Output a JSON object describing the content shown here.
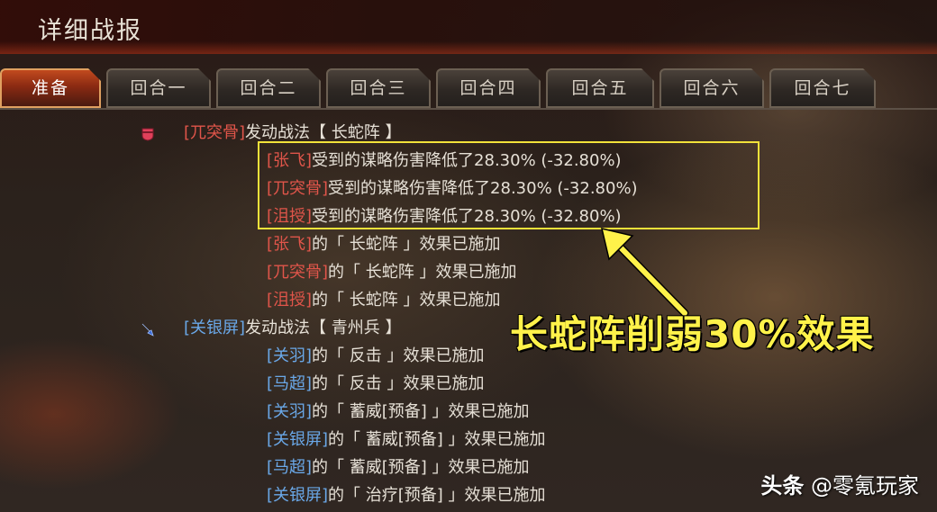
{
  "header": {
    "title": "详细战报"
  },
  "tabs": [
    {
      "label": "准备",
      "active": true
    },
    {
      "label": "回合一",
      "active": false
    },
    {
      "label": "回合二",
      "active": false
    },
    {
      "label": "回合三",
      "active": false
    },
    {
      "label": "回合四",
      "active": false
    },
    {
      "label": "回合五",
      "active": false
    },
    {
      "label": "回合六",
      "active": false
    },
    {
      "label": "回合七",
      "active": false
    }
  ],
  "log": [
    {
      "icon": "red-shield-icon",
      "parts": [
        {
          "t": "[兀突骨]",
          "c": "red"
        },
        {
          "t": "发动战法【 长蛇阵 】",
          "c": ""
        }
      ]
    },
    {
      "parts": [
        {
          "t": "[张飞]",
          "c": "red"
        },
        {
          "t": "受到的谋略伤害降低了28.30% (-32.80%)",
          "c": ""
        }
      ]
    },
    {
      "parts": [
        {
          "t": "[兀突骨]",
          "c": "red"
        },
        {
          "t": "受到的谋略伤害降低了28.30% (-32.80%)",
          "c": ""
        }
      ]
    },
    {
      "parts": [
        {
          "t": "[沮授]",
          "c": "red"
        },
        {
          "t": "受到的谋略伤害降低了28.30% (-32.80%)",
          "c": ""
        }
      ]
    },
    {
      "parts": [
        {
          "t": "[张飞]",
          "c": "red"
        },
        {
          "t": "的「 长蛇阵 」效果已施加",
          "c": ""
        }
      ]
    },
    {
      "parts": [
        {
          "t": "[兀突骨]",
          "c": "red"
        },
        {
          "t": "的「 长蛇阵 」效果已施加",
          "c": ""
        }
      ]
    },
    {
      "parts": [
        {
          "t": "[沮授]",
          "c": "red"
        },
        {
          "t": "的「 长蛇阵 」效果已施加",
          "c": ""
        }
      ]
    },
    {
      "icon": "blue-spear-icon",
      "parts": [
        {
          "t": "[关银屏]",
          "c": "blue"
        },
        {
          "t": "发动战法【 青州兵 】",
          "c": ""
        }
      ]
    },
    {
      "parts": [
        {
          "t": "[关羽]",
          "c": "blue"
        },
        {
          "t": "的「 反击 」效果已施加",
          "c": ""
        }
      ]
    },
    {
      "parts": [
        {
          "t": "[马超]",
          "c": "blue"
        },
        {
          "t": "的「 反击 」效果已施加",
          "c": ""
        }
      ]
    },
    {
      "parts": [
        {
          "t": "[关羽]",
          "c": "blue"
        },
        {
          "t": "的「 蓄威[预备] 」效果已施加",
          "c": ""
        }
      ]
    },
    {
      "parts": [
        {
          "t": "[关银屏]",
          "c": "blue"
        },
        {
          "t": "的「 蓄威[预备] 」效果已施加",
          "c": ""
        }
      ]
    },
    {
      "parts": [
        {
          "t": "[马超]",
          "c": "blue"
        },
        {
          "t": "的「 蓄威[预备] 」效果已施加",
          "c": ""
        }
      ]
    },
    {
      "parts": [
        {
          "t": "[关银屏]",
          "c": "blue"
        },
        {
          "t": "的「 治疗[预备] 」效果已施加",
          "c": ""
        }
      ]
    }
  ],
  "annotation": {
    "text": "长蛇阵削弱30%效果"
  },
  "watermark": {
    "brand": "头条",
    "handle": "@零氪玩家"
  },
  "colors": {
    "red_name": "#e0554a",
    "blue_name": "#6aa8e8",
    "highlight": "#f2e23a",
    "active_tab": "#c24a1e"
  }
}
